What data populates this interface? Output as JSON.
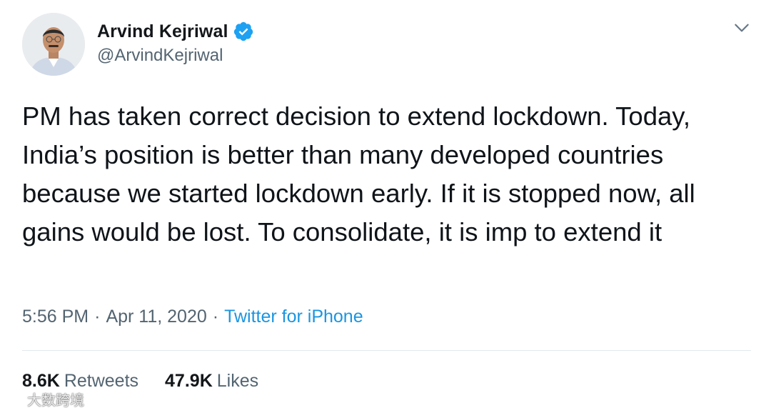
{
  "author": {
    "display_name": "Arvind Kejriwal",
    "handle": "@ArvindKejriwal",
    "verified": true
  },
  "tweet": {
    "text": "PM has taken correct decision to extend lockdown. Today, India’s position is better than many developed countries because we started lockdown early. If it is stopped now, all gains would be lost. To consolidate, it is imp to extend it"
  },
  "meta": {
    "time": "5:56 PM",
    "separator": "·",
    "date": "Apr 11, 2020",
    "source": "Twitter for iPhone"
  },
  "stats": {
    "retweets_count": "8.6K",
    "retweets_label": "Retweets",
    "likes_count": "47.9K",
    "likes_label": "Likes"
  },
  "watermark": {
    "text": "大数跨境"
  },
  "colors": {
    "verified_blue": "#1da1f2",
    "link_blue": "#1b95e0",
    "secondary_text": "#536471",
    "divider": "#e1e8ed"
  },
  "icons": {
    "verified": "verified-badge-icon",
    "menu": "chevron-down-icon"
  }
}
